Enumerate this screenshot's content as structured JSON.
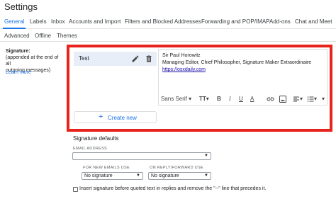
{
  "page": {
    "title": "Settings"
  },
  "tabs": [
    {
      "label": "General",
      "active": true
    },
    {
      "label": "Labels"
    },
    {
      "label": "Inbox"
    },
    {
      "label": "Accounts and Import"
    },
    {
      "label": "Filters and Blocked Addresses"
    },
    {
      "label": "Forwarding and POP/IMAP"
    },
    {
      "label": "Add-ons"
    },
    {
      "label": "Chat and Meet"
    }
  ],
  "tabs2": [
    {
      "label": "Advanced"
    },
    {
      "label": "Offline"
    },
    {
      "label": "Themes"
    }
  ],
  "signature_section": {
    "label": "Signature:",
    "note_line1": "(appended at the end of all",
    "note_line2": "outgoing messages)",
    "learn_more": "Learn more"
  },
  "signatures": [
    {
      "name": "Test",
      "selected": true
    }
  ],
  "create_new": {
    "label": "Create new"
  },
  "editor": {
    "line1": "Sir Paul Horowitz",
    "line2": "Managing Editor, Chief Philosopher, Signature Maker Extraordinaire",
    "link": "https://osxdaily.com"
  },
  "toolbar": {
    "font": "Sans Serif",
    "size_icon": "text-size-icon",
    "bold": "B",
    "italic": "I",
    "underline": "U",
    "text_color": "A",
    "link_icon": "link-icon",
    "image_icon": "image-icon",
    "align_icon": "align-icon",
    "list_icon": "list-icon",
    "more_icon": "more-formatting-icon"
  },
  "defaults": {
    "title": "Signature defaults",
    "email_address_label": "EMAIL ADDRESS",
    "email_address_value": "",
    "new_emails_label": "FOR NEW EMAILS USE",
    "new_emails_value": "No signature",
    "reply_label": "ON REPLY/FORWARD USE",
    "reply_value": "No signature"
  },
  "checkbox": {
    "label": "Insert signature before quoted text in replies and remove the \"--\" line that precedes it.",
    "checked": false
  },
  "colors": {
    "accent": "#1a73e8",
    "highlight_frame": "#e8231b",
    "selected_row": "#e8eef8"
  }
}
